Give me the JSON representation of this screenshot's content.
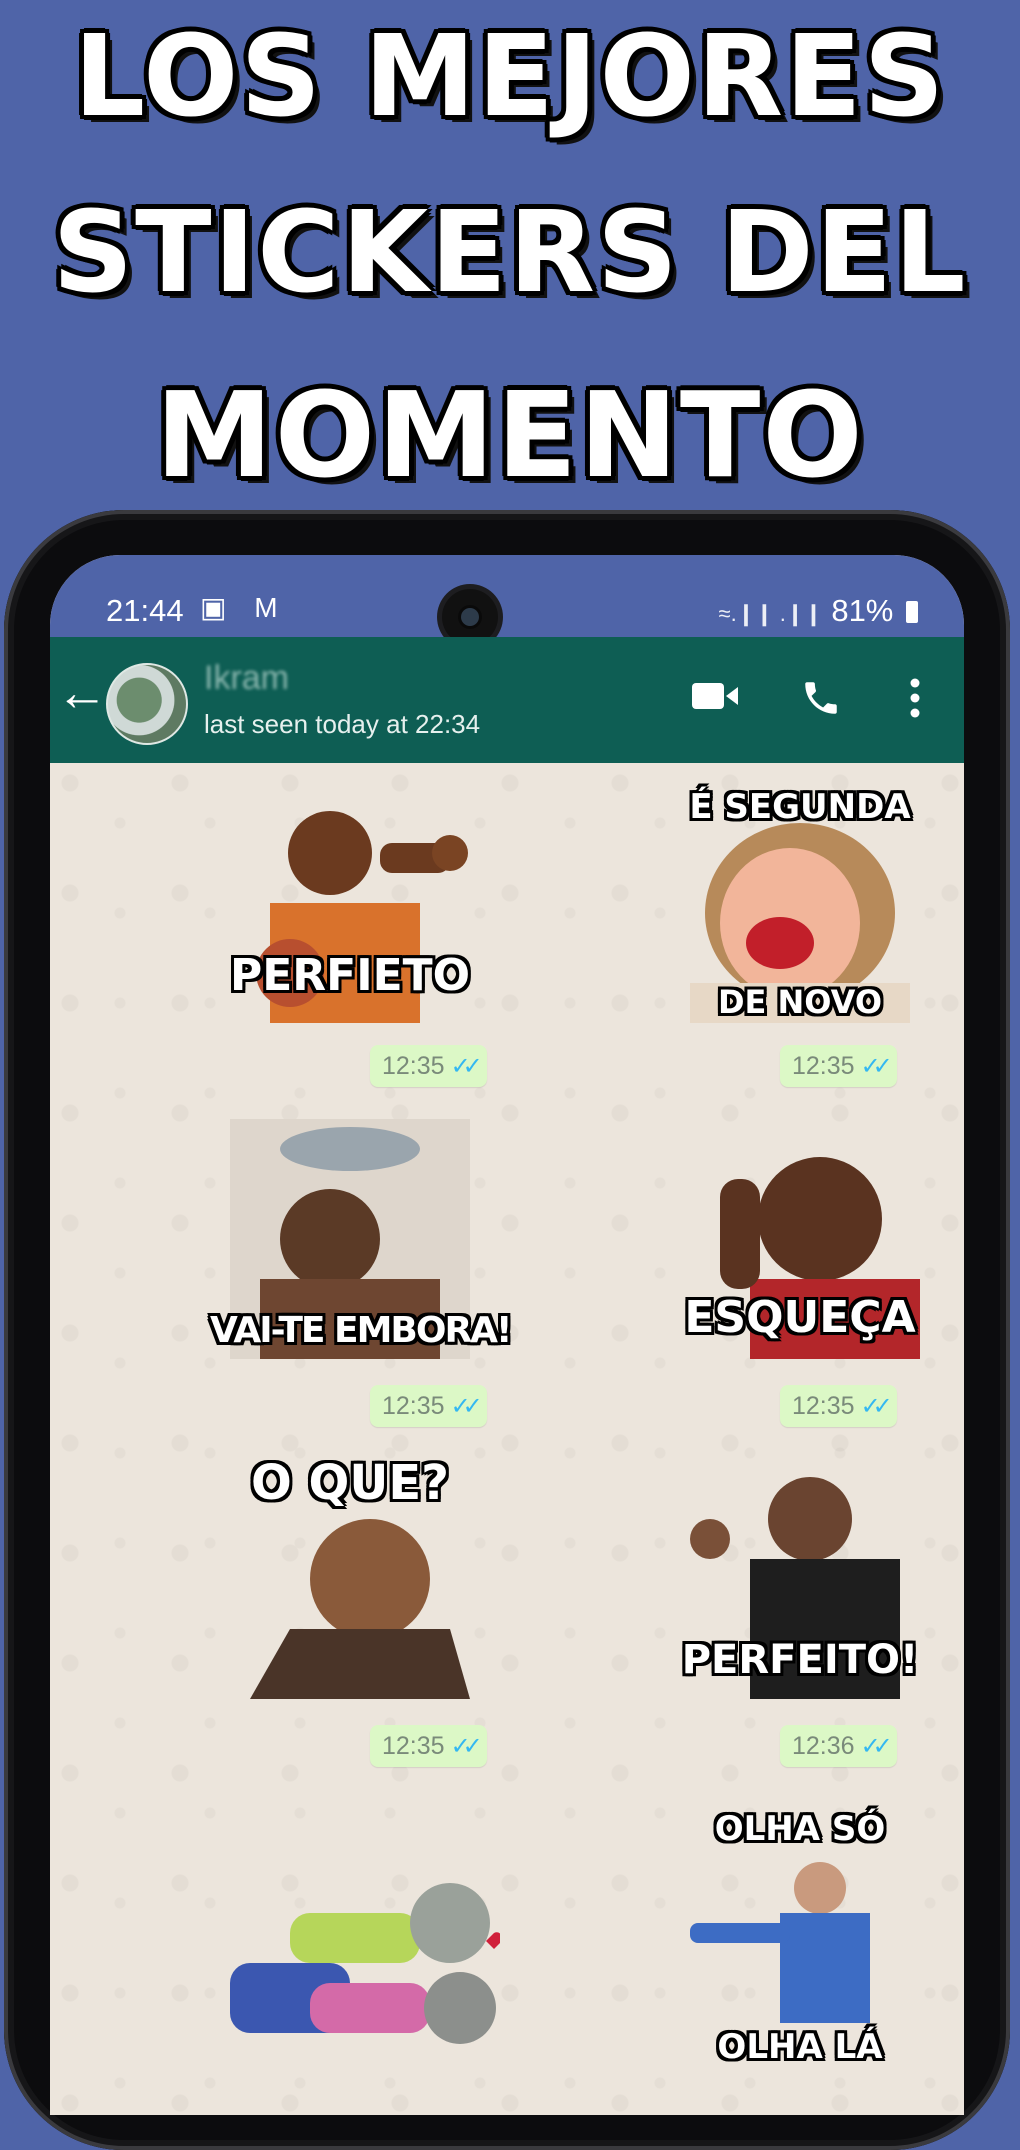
{
  "headline": {
    "line1": "LOS MEJORES",
    "line2": "STICKERS DEL",
    "line3": "MOMENTO"
  },
  "status_bar": {
    "time": "21:44",
    "left_icons": "▣ M",
    "battery": "81%",
    "signal_icons": "≈.❙❙ .❙❙"
  },
  "chat_header": {
    "contact_name": "Ikram",
    "last_seen": "last seen today at 22:34",
    "back_icon": "←"
  },
  "messages": [
    {
      "sticker_top_text": "",
      "sticker_bottom_text": "PERFIETO",
      "time": "12:35",
      "ticks": "✓✓"
    },
    {
      "sticker_top_text": "É SEGUNDA",
      "sticker_bottom_text": "DE NOVO",
      "time": "12:35",
      "ticks": "✓✓"
    },
    {
      "sticker_top_text": "",
      "sticker_bottom_text": "VAI-TE EMBORA!",
      "time": "12:35",
      "ticks": "✓✓"
    },
    {
      "sticker_top_text": "",
      "sticker_bottom_text": "ESQUEÇA",
      "time": "12:35",
      "ticks": "✓✓"
    },
    {
      "sticker_top_text": "O QUE?",
      "sticker_bottom_text": "",
      "time": "12:35",
      "ticks": "✓✓"
    },
    {
      "sticker_top_text": "",
      "sticker_bottom_text": "PERFEITO!",
      "time": "12:36",
      "ticks": "✓✓"
    },
    {
      "sticker_top_text": "",
      "sticker_bottom_text": "",
      "time": "",
      "ticks": ""
    },
    {
      "sticker_top_text": "OLHA SÓ",
      "sticker_bottom_text": "OLHA LÁ",
      "time": "",
      "ticks": ""
    }
  ],
  "colors": {
    "background": "#4f64a8",
    "whatsapp_header": "#0e5e54",
    "bubble": "#dcf8c6",
    "read_ticks": "#34b7f1"
  }
}
